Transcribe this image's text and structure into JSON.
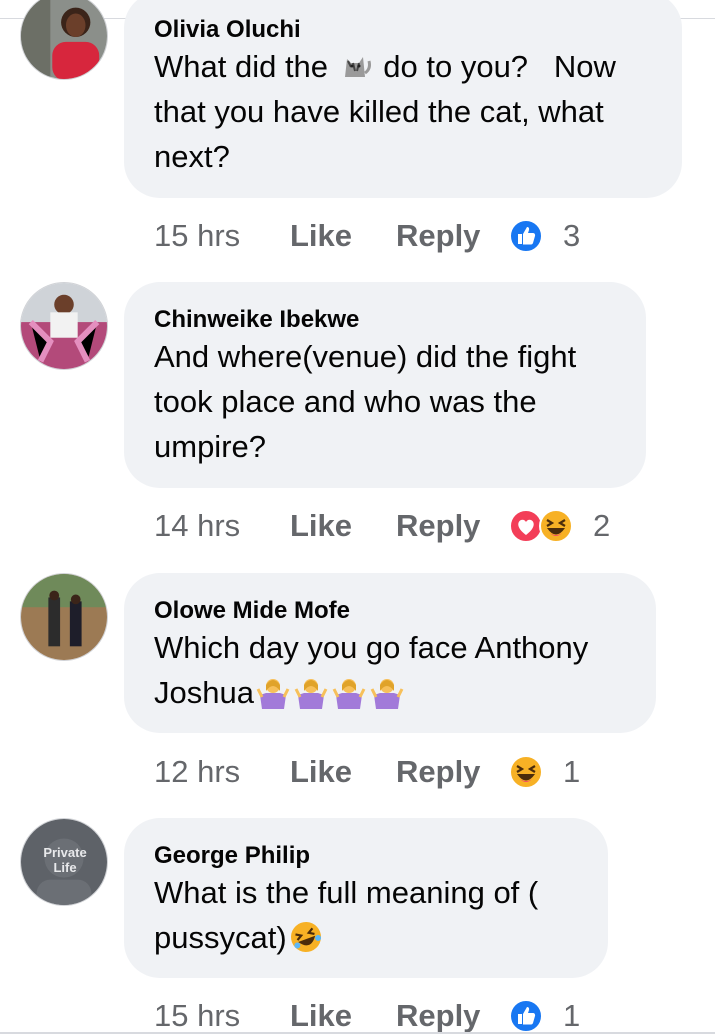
{
  "comments": [
    {
      "author": "Olivia Oluchi",
      "text_part1": "What did the ",
      "text_part2": " do to you?   Now that you have killed the cat, what next?",
      "time": "15 hrs",
      "like_label": "Like",
      "reply_label": "Reply",
      "reaction_count": "3",
      "inline_emoji": "cat-emoji",
      "reactions": [
        "like-reaction-icon"
      ]
    },
    {
      "author": "Chinweike Ibekwe",
      "text": "And where(venue) did the fight took place and who was the umpire?",
      "time": "14 hrs",
      "like_label": "Like",
      "reply_label": "Reply",
      "reaction_count": "2",
      "reactions": [
        "love-reaction-icon",
        "haha-reaction-icon"
      ]
    },
    {
      "author": "Olowe Mide Mofe",
      "text": "Which day you go face Anthony Joshua",
      "time": "12 hrs",
      "like_label": "Like",
      "reply_label": "Reply",
      "reaction_count": "1",
      "inline_emoji": "woman-shrugging-emoji",
      "reactions": [
        "haha-reaction-icon"
      ]
    },
    {
      "author": "George Philip",
      "text": "What is the full meaning of ( pussycat)",
      "avatar_text": "Private Life",
      "time": "15 hrs",
      "like_label": "Like",
      "reply_label": "Reply",
      "reaction_count": "1",
      "inline_emoji": "rolling-laughing-emoji",
      "reactions": [
        "like-reaction-icon"
      ]
    }
  ],
  "colors": {
    "bubble": "#f0f2f5",
    "meta_text": "#65676b",
    "like_blue": "#1877f2",
    "love_red": "#f33e58",
    "haha_yellow": "#f7b125"
  }
}
